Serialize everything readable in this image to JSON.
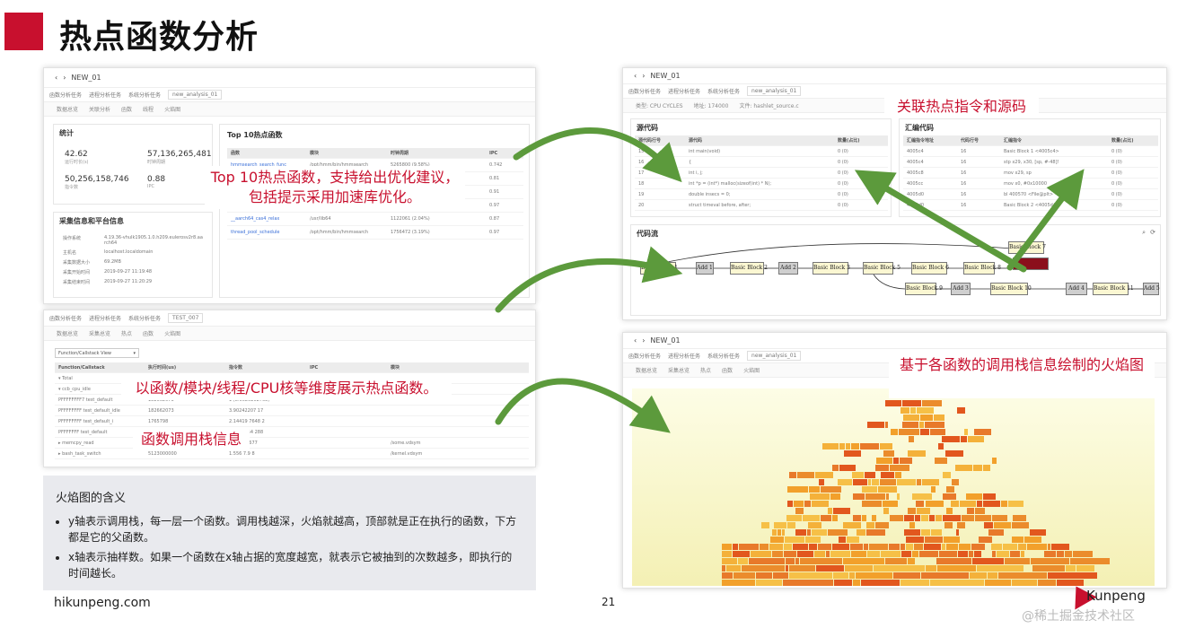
{
  "slide": {
    "title": "热点函数分析",
    "footer": "hikunpeng.com",
    "page": "21",
    "logo": "Kunpeng",
    "watermark": "@稀土掘金技术社区"
  },
  "colors": {
    "accent": "#c8102e",
    "arrow": "#5c9a3c",
    "flame_hot": "#e2571e",
    "flame_warm": "#f2a02b",
    "flame_mid": "#f6c047"
  },
  "callouts": {
    "top10": [
      "Top 10热点函数，支持给出优化建议，",
      "包括提示采用加速库优化。"
    ],
    "dims": "以函数/模块/线程/CPU核等维度展示热点函数。",
    "callstack": "函数调用栈信息",
    "linked": "关联热点指令和源码",
    "flame": "基于各函数的调用栈信息绘制的火焰图"
  },
  "panel_a": {
    "breadcrumb": "NEW_01",
    "tabs": [
      "函数分析任务",
      "进程分析任务",
      "系统分析任务",
      "new_analysis_01"
    ],
    "subtabs": [
      "数据总览",
      "关联分析",
      "函数",
      "线程",
      "火焰图"
    ],
    "stats": {
      "title": "统计",
      "items": [
        {
          "value": "42.62",
          "label": "运行时长(s)"
        },
        {
          "value": "57,136,265,481",
          "label": "时钟周期"
        },
        {
          "value": "50,256,158,746",
          "label": "指令数"
        },
        {
          "value": "0.88",
          "label": "IPC"
        }
      ]
    },
    "sysinfo": {
      "title": "采集信息和平台信息",
      "items": [
        {
          "k": "操作系统",
          "v": "4.19.36-vhulk1905.1.0.h209.eulerosv2r8.aarch64"
        },
        {
          "k": "主机名",
          "v": "localhost.localdomain"
        },
        {
          "k": "采集数据大小",
          "v": "69.2MB"
        },
        {
          "k": "采集开始时间",
          "v": "2019-09-27 11:19:48"
        },
        {
          "k": "采集结束时间",
          "v": "2019-09-27 11:20:29"
        }
      ]
    },
    "top10": {
      "title": "Top 10热点函数",
      "headers": [
        "函数",
        "模块",
        "时钟周期",
        "IPC"
      ],
      "rows": [
        [
          "hmmsearch_search_func",
          "/opt/hmm/bin/hmmsearch",
          "5265800 (9.58%)",
          "0.742"
        ],
        [
          "memcpy_function_large",
          "/usr/lib64",
          "5176205 (9.41%)",
          "0.81"
        ],
        [
          "calc_score_vector_simd",
          "/usr/lib64",
          "1793204 (3.26%)",
          "0.91"
        ],
        [
          "memset",
          "/usr/lib64",
          "1654471 (3.01%)",
          "0.97"
        ],
        [
          "__aarch64_cas4_relax",
          "/usr/lib64",
          "1122061 (2.04%)",
          "0.87"
        ],
        [
          "thread_pool_schedule",
          "/opt/hmm/bin/hmmsearch",
          "1756472 (3.19%)",
          "0.97"
        ]
      ]
    }
  },
  "panel_b": {
    "tabs": [
      "函数分析任务",
      "进程分析任务",
      "系统分析任务",
      "TEST_007"
    ],
    "subtabs": [
      "数据总览",
      "采集总览",
      "热点",
      "函数",
      "火焰图"
    ],
    "dropdown": "Function/Callstack View",
    "headers": [
      "Function/Callstack",
      "执行时间(us)",
      "指令数",
      "IPC",
      "模块"
    ],
    "rows": [
      [
        "▾ Total",
        "",
        "",
        "",
        ""
      ],
      [
        "  ▾ ccb_cpu_idle",
        "",
        "",
        "",
        "/kernel.vmlinux"
      ],
      [
        "    PFFFFFFFF7 test_default",
        "182662073",
        "1 (8.0626262768)",
        "",
        ""
      ],
      [
        "    PFFFFFFFF test_default_idle",
        "182662073",
        "3.90242207 17",
        "",
        ""
      ],
      [
        "    PFFFFFFFF test_default_i",
        "1765798",
        "2.14419 7648 2",
        "",
        ""
      ],
      [
        "    PFFFFFFF test_default",
        "8103462",
        "1.0290964 288",
        "",
        ""
      ],
      [
        "  ▸ memcpy_read",
        "83937076",
        "3.8234 1677",
        "",
        "/some.vdsym"
      ],
      [
        "  ▸ bash_task_switch",
        "5123000000",
        "1.556 7.9 8",
        "",
        "/kernel.vdsym"
      ]
    ]
  },
  "panel_c": {
    "breadcrumb": "NEW_01",
    "tabs": [
      "函数分析任务",
      "进程分析任务",
      "系统分析任务",
      "new_analysis_01"
    ],
    "info": [
      "类型: CPU CYCLES",
      "地址: 174000",
      "文件: hashlet_source.c"
    ],
    "source": {
      "title": "源代码",
      "headers": [
        "源代码行号",
        "源代码",
        "数量(占比)"
      ],
      "rows": [
        [
          "15",
          "int main(void)",
          "0 (0)"
        ],
        [
          "16",
          "{",
          "0 (0)"
        ],
        [
          "17",
          "int i, j;",
          "0 (0)"
        ],
        [
          "18",
          "int *p = (int*) malloc(sizeof(int) * N);",
          "0 (0)"
        ],
        [
          "19",
          "double insecs = 0;",
          "0 (0)"
        ],
        [
          "20",
          "struct timeval before, after;",
          "0 (0)"
        ]
      ]
    },
    "asm": {
      "title": "汇编代码",
      "headers": [
        "汇编指令地址",
        "代码行号",
        "汇编指令",
        "数量(占比)"
      ],
      "rows": [
        [
          "4005c4",
          "16",
          "Basic Block 1 <4005c4>",
          "0 (0)"
        ],
        [
          "4005c4",
          "16",
          "stp x29, x30, [sp, #-48]!",
          "0 (0)"
        ],
        [
          "4005c8",
          "16",
          "mov x29, sp",
          "0 (0)"
        ],
        [
          "4005cc",
          "16",
          "mov x0, #0x10000",
          "0 (0)"
        ],
        [
          "4005d0",
          "16",
          "bl 400570 <File@plt>",
          "0 (0)"
        ],
        [
          "4005d0",
          "16",
          "Basic Block 2 <4005d4>",
          "0 (0)"
        ]
      ]
    },
    "flow_title": "代码流",
    "blocks": [
      "Basic Block 1",
      "Add 1",
      "Basic Block 2",
      "Add 2",
      "Basic Block 3",
      "Basic Block 5",
      "Basic Block 6",
      "Basic Block 8",
      "Basic Block 7",
      "Basic Block 9",
      "Add 3",
      "Basic Block 10",
      "Add 4",
      "Basic Block 11",
      "Add 5"
    ]
  },
  "panel_d": {
    "breadcrumb": "NEW_01",
    "tabs": [
      "函数分析任务",
      "进程分析任务",
      "系统分析任务",
      "new_analysis_01"
    ],
    "subtabs": [
      "数据总览",
      "采集总览",
      "热点",
      "函数",
      "火焰图"
    ]
  },
  "notes": {
    "title": "火焰图的含义",
    "items": [
      "y轴表示调用栈，每一层一个函数。调用栈越深，火焰就越高，顶部就是正在执行的函数，下方都是它的父函数。",
      "x轴表示抽样数。如果一个函数在x轴占据的宽度越宽，就表示它被抽到的次数越多，即执行的时间越长。"
    ]
  }
}
